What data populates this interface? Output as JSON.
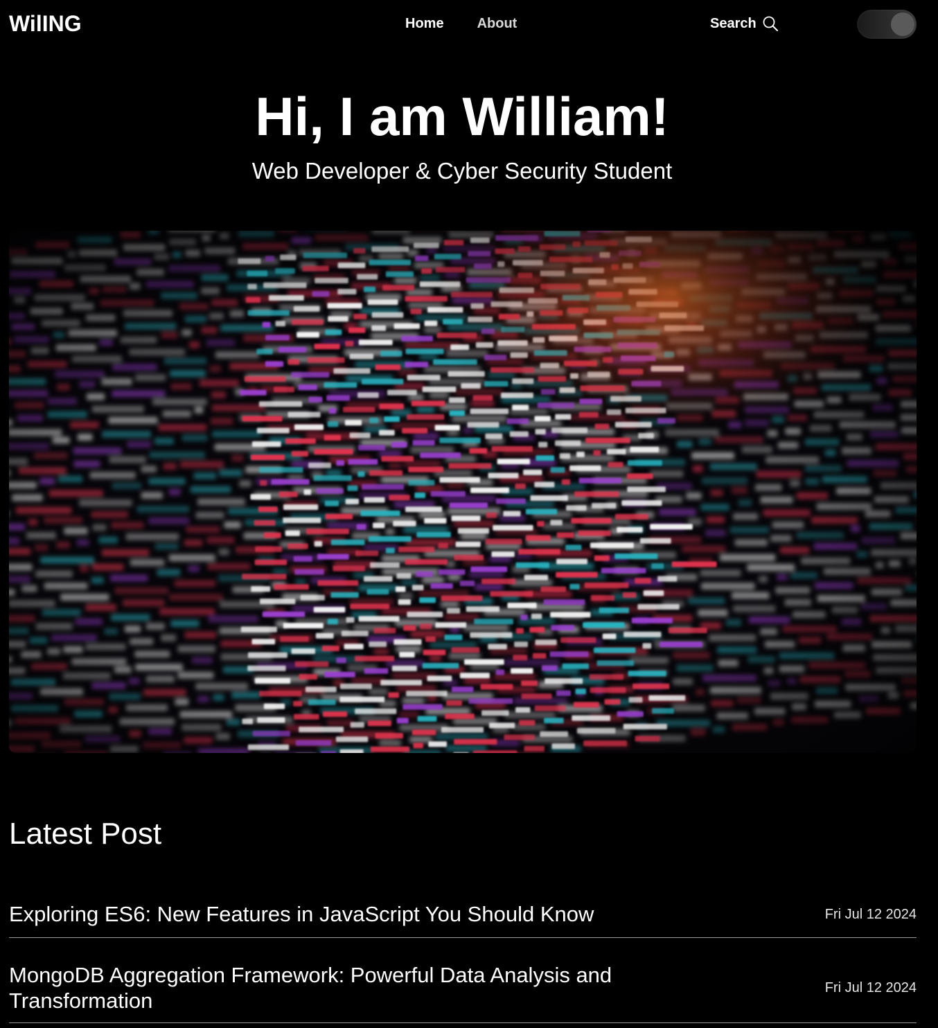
{
  "header": {
    "logo": "WilING",
    "nav": [
      {
        "label": "Home"
      },
      {
        "label": "About"
      }
    ],
    "search_label": "Search"
  },
  "hero": {
    "title": "Hi, I am William!",
    "subtitle": "Web Developer & Cyber Security Student"
  },
  "latest": {
    "heading": "Latest Post",
    "posts": [
      {
        "title": "Exploring ES6: New Features in JavaScript You Should Know",
        "date": "Fri Jul 12 2024"
      },
      {
        "title": "MongoDB Aggregation Framework: Powerful Data Analysis and Transformation",
        "date": "Fri Jul 12 2024"
      }
    ]
  },
  "colors": {
    "background": "#000000",
    "text": "#ffffff",
    "code_red": "#e0334d",
    "code_white": "#f2f2f2",
    "code_teal": "#28b3c0",
    "code_purple": "#9a3fd0",
    "glow_orange": "#ff7a2a"
  },
  "icons": {
    "search": "search-icon",
    "theme_toggle": "theme-toggle"
  }
}
